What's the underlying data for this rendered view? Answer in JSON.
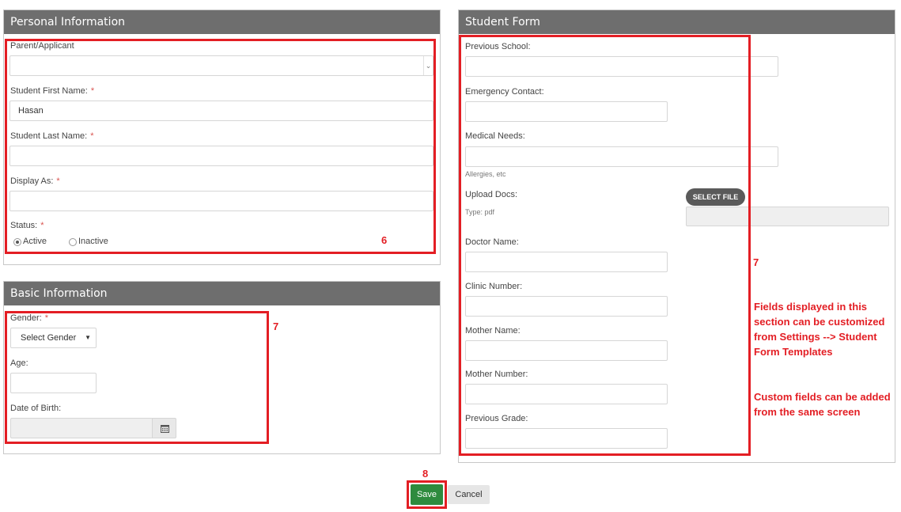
{
  "personal": {
    "title": "Personal Information",
    "parent_label": "Parent/Applicant",
    "first_name_label": "Student First Name:",
    "first_name_value": "Hasan",
    "last_name_label": "Student Last Name:",
    "display_as_label": "Display As:",
    "status_label": "Status:",
    "status_options": [
      "Active",
      "Inactive"
    ],
    "required_mark": "*"
  },
  "basic": {
    "title": "Basic Information",
    "gender_label": "Gender:",
    "gender_value": "Select Gender",
    "age_label": "Age:",
    "dob_label": "Date of Birth:"
  },
  "student_form": {
    "title": "Student Form",
    "previous_school_label": "Previous School:",
    "emergency_contact_label": "Emergency Contact:",
    "medical_needs_label": "Medical Needs:",
    "medical_needs_hint": "Allergies, etc",
    "upload_docs_label": "Upload Docs:",
    "upload_docs_hint": "Type: pdf",
    "select_file_label": "SELECT FILE",
    "doctor_name_label": "Doctor Name:",
    "clinic_number_label": "Clinic Number:",
    "mother_name_label": "Mother Name:",
    "mother_number_label": "Mother Number:",
    "previous_grade_label": "Previous Grade:"
  },
  "actions": {
    "save_label": "Save",
    "cancel_label": "Cancel"
  },
  "annotations": {
    "n6": "6",
    "n7a": "7",
    "n7b": "7",
    "n8": "8",
    "note1": "Fields displayed in this section can be customized from Settings --> Student Form Templates",
    "note2": "Custom fields can be added from the same screen"
  },
  "colors": {
    "panel_header": "#6e6e6e",
    "annotation_red": "#e31e24",
    "save_green": "#2e8b3e",
    "cancel_gray": "#e6e6e6"
  },
  "icons": {
    "select_caret": "chevron-down-icon",
    "calendar": "calendar-icon"
  }
}
